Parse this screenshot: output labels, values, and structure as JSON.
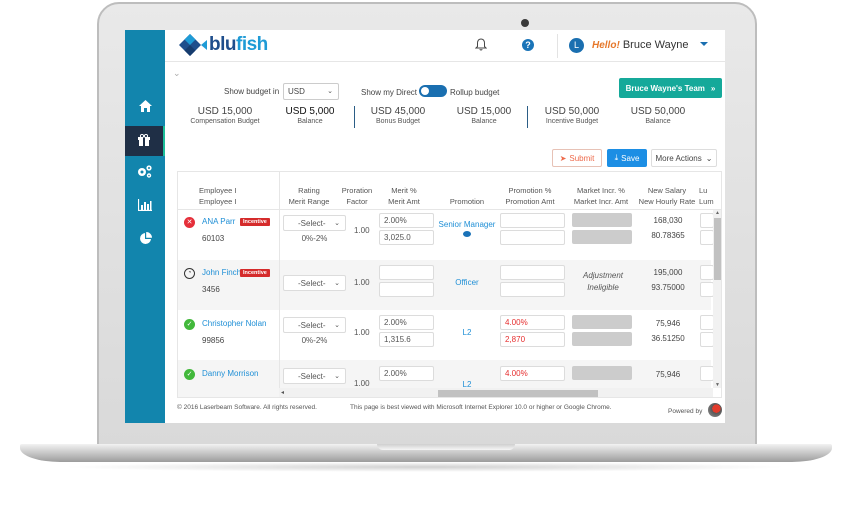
{
  "app": {
    "logo": {
      "part1": "blu",
      "part2": "fish"
    },
    "header": {
      "greeting": "Hello!",
      "user_name": "Bruce Wayne",
      "avatar_initial": "L",
      "bell_icon": "bell-icon",
      "help_icon": "question-circle-icon",
      "help_glyph": "?"
    }
  },
  "sidebar": {
    "items": [
      {
        "icon": "home-icon",
        "glyph": "⌂",
        "active": false
      },
      {
        "icon": "gift-icon",
        "glyph": "🎁︎",
        "active": true
      },
      {
        "icon": "gears-icon",
        "glyph": "⚙",
        "active": false
      },
      {
        "icon": "bar-chart-icon",
        "glyph": "▥",
        "active": false
      },
      {
        "icon": "pie-chart-icon",
        "glyph": "◕",
        "active": false
      }
    ]
  },
  "controls": {
    "collapse_glyph": "⌄",
    "show_budget_label": "Show budget in",
    "currency_value": "USD",
    "show_direct_label": "Show my Direct",
    "rollup_label": "Rollup budget",
    "team_button": "Bruce Wayne's Team",
    "team_button_icon": "»"
  },
  "budgets": [
    {
      "amount": "USD 15,000",
      "caption": "Compensation Budget"
    },
    {
      "amount": "USD 5,000",
      "caption": "Balance"
    },
    {
      "amount": "USD 45,000",
      "caption": "Bonus Budget"
    },
    {
      "amount": "USD 15,000",
      "caption": "Balance"
    },
    {
      "amount": "USD 50,000",
      "caption": "Incentive Budget"
    },
    {
      "amount": "USD 50,000",
      "caption": "Balance"
    }
  ],
  "actions": {
    "submit": "Submit",
    "submit_glyph": "➤",
    "save": "Save",
    "save_glyph": "⤓",
    "more": "More Actions",
    "more_glyph": "⌄"
  },
  "table": {
    "headers": {
      "employee": [
        "Employee I",
        "Employee I"
      ],
      "rating": [
        "Rating",
        "Merit Range"
      ],
      "proration": [
        "Proration",
        "Factor"
      ],
      "merit": [
        "Merit %",
        "Merit Amt"
      ],
      "promotion": [
        "Promotion"
      ],
      "promotion_pct": [
        "Promotion %",
        "Promotion Amt"
      ],
      "market": [
        "Market Incr. %",
        "Market Incr. Amt"
      ],
      "salary": [
        "New Salary",
        "New Hourly Rate"
      ],
      "lump": [
        "Lu",
        "Lum"
      ]
    },
    "select_placeholder": "-Select-",
    "rows": [
      {
        "status": "rejected",
        "status_glyph": "✕",
        "name": "ANA Parr",
        "badge": "Incentive",
        "id": "60103",
        "merit_range": "0%-2%",
        "factor": "1.00",
        "merit_pct": "2.00%",
        "merit_amt": "3,025.0",
        "promotion": "Senior Manager",
        "promo_pct": "",
        "promo_amt": "",
        "market": "gray",
        "new_salary": "168,030",
        "hourly": "80.78365"
      },
      {
        "status": "pending",
        "status_glyph": "◔",
        "name": "John Finch",
        "badge": "Incentive",
        "id": "3456",
        "merit_range": "",
        "factor": "1.00",
        "merit_pct": "",
        "merit_amt": "",
        "promotion": "Officer",
        "promo_pct": "",
        "promo_amt": "",
        "market_text": [
          "Adjustment",
          "Ineligible"
        ],
        "new_salary": "195,000",
        "hourly": "93.75000"
      },
      {
        "status": "approved",
        "status_glyph": "✓",
        "name": "Christopher Nolan",
        "badge": "",
        "id": "99856",
        "merit_range": "0%-2%",
        "factor": "1.00",
        "merit_pct": "2.00%",
        "merit_amt": "1,315.6",
        "promotion": "L2",
        "promo_pct": "4.00%",
        "promo_amt": "2,870",
        "market": "gray",
        "new_salary": "75,946",
        "hourly": "36.51250"
      },
      {
        "status": "approved",
        "status_glyph": "✓",
        "name": "Danny Morrison",
        "badge": "",
        "id": "",
        "merit_range": "",
        "factor": "1.00",
        "merit_pct": "2.00%",
        "merit_amt": "",
        "promotion": "L2",
        "promo_pct": "4.00%",
        "promo_amt": "",
        "market": "gray",
        "new_salary": "75,946",
        "hourly": ""
      }
    ]
  },
  "footer": {
    "copyright": "© 2016 Laserbeam Software. All rights reserved.",
    "browser_note": "This page is best viewed with Microsoft Internet Explorer 10.0 or higher or Google Chrome.",
    "powered_by": "Powered by"
  }
}
